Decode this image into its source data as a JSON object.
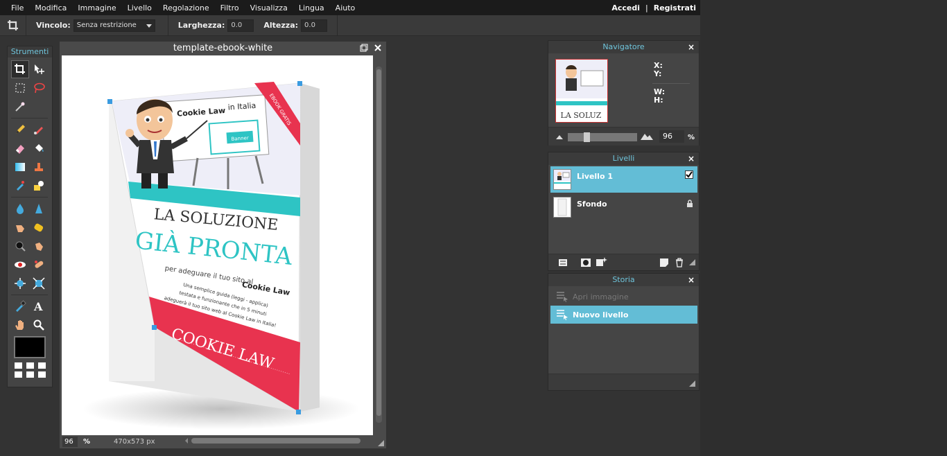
{
  "menubar": {
    "items": [
      "File",
      "Modifica",
      "Immagine",
      "Livello",
      "Regolazione",
      "Filtro",
      "Visualizza",
      "Lingua",
      "Aiuto"
    ],
    "login": "Accedi",
    "separator": "|",
    "register": "Registrati"
  },
  "optionbar": {
    "constraint_label": "Vincolo:",
    "constraint_value": "Senza restrizione",
    "width_label": "Larghezza:",
    "width_value": "0.0",
    "height_label": "Altezza:",
    "height_value": "0.0"
  },
  "tools": {
    "title": "Strumenti",
    "foreground_color": "#000000"
  },
  "canvas": {
    "title": "template-ebook-white",
    "zoom": "96",
    "zoom_unit": "%",
    "dimensions": "470x573 px"
  },
  "book": {
    "header": "Cookie Law",
    "header_suffix": "in Italia",
    "ribbon": "EBOOK GRATIS",
    "banner": "Banner",
    "line1": "LA SOLUZIONE",
    "line2": "GIÀ PRONTA",
    "line3": "per adeguare il tuo sito al",
    "line3_bold": "Cookie Law",
    "desc1": "Una semplice guida (leggi - applica)",
    "desc2": "testata e funzionante che in 5 minuti",
    "desc3": "adeguerà il tuo sito web al Cookie Law in Italia!",
    "footer": "COOKIE LAW"
  },
  "navigator": {
    "title": "Navigatore",
    "thumb_text": "LA SOLUZ",
    "x_label": "X:",
    "y_label": "Y:",
    "w_label": "W:",
    "h_label": "H:",
    "zoom": "96",
    "zoom_unit": "%",
    "zoom_fraction": 0.25
  },
  "layers": {
    "title": "Livelli",
    "items": [
      {
        "name": "Livello 1",
        "visible": true
      },
      {
        "name": "Sfondo",
        "locked": true
      }
    ]
  },
  "history": {
    "title": "Storia",
    "items": [
      {
        "name": "Apri immagine"
      },
      {
        "name": "Nuovo livello"
      }
    ]
  },
  "colors": {
    "accent": "#63bdd6",
    "teal": "#2ec4c4",
    "red": "#e8334f"
  }
}
